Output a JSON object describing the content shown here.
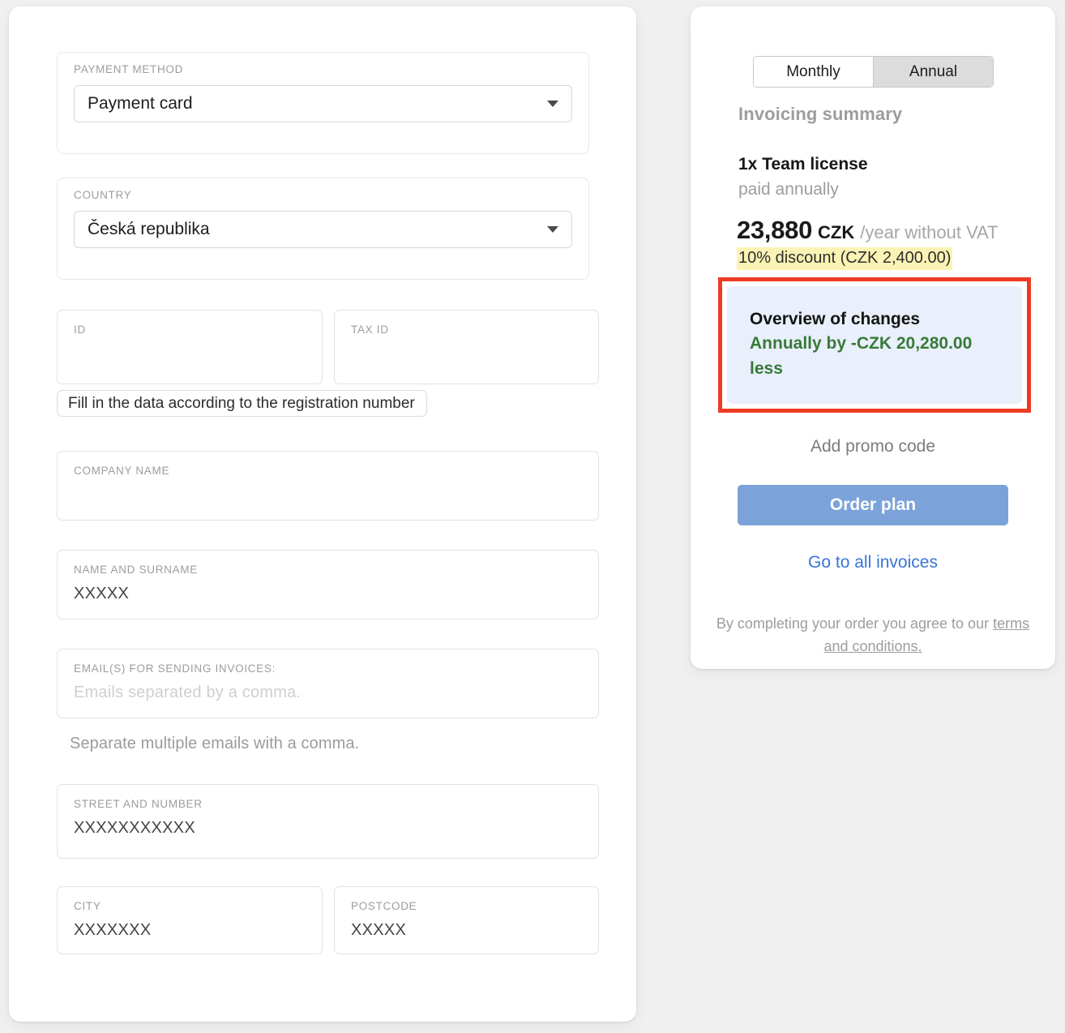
{
  "form": {
    "payment_method": {
      "label": "PAYMENT METHOD",
      "value": "Payment card",
      "caret_icon": "chevron-down-icon"
    },
    "country": {
      "label": "COUNTRY",
      "value": "Česká republika",
      "caret_icon": "chevron-down-icon"
    },
    "id": {
      "label": "ID",
      "value": ""
    },
    "tax_id": {
      "label": "TAX ID",
      "value": ""
    },
    "fill_button_label": "Fill in the data according to the registration number",
    "company_name": {
      "label": "COMPANY NAME",
      "value": ""
    },
    "name_and_surname": {
      "label": "NAME AND SURNAME",
      "value": "XXXXX"
    },
    "emails": {
      "label": "EMAIL(S) FOR SENDING INVOICES:",
      "placeholder": "Emails separated by a comma.",
      "value": ""
    },
    "emails_helper": "Separate multiple emails with a comma.",
    "street": {
      "label": "STREET AND NUMBER",
      "value": "XXXXXXXXXXX"
    },
    "city": {
      "label": "CITY",
      "value": "XXXXXXX"
    },
    "postcode": {
      "label": "POSTCODE",
      "value": "XXXXX"
    }
  },
  "summary": {
    "billing_cycle": {
      "monthly_label": "Monthly",
      "annual_label": "Annual",
      "selected": "Annual"
    },
    "title": "Invoicing summary",
    "license_line": "1x Team license",
    "paid_line": "paid annually",
    "price": {
      "amount": "23,880",
      "currency": "CZK",
      "period": "/year without VAT"
    },
    "discount_badge": "10% discount (CZK 2,400.00)",
    "changes": {
      "title": "Overview of changes",
      "value": "Annually by -CZK 20,280.00 less"
    },
    "promo_label": "Add promo code",
    "order_button_label": "Order plan",
    "invoices_link_label": "Go to all invoices",
    "terms_prefix": "By completing your order you agree to our",
    "terms_link_label": "terms and conditions."
  },
  "colors": {
    "accent_button": "#7ba3da",
    "link": "#3875d7",
    "highlight_border": "#ee3b24",
    "changes_bg": "#e9effb",
    "changes_value": "#387a38",
    "discount_highlight": "#fbf3b4"
  }
}
